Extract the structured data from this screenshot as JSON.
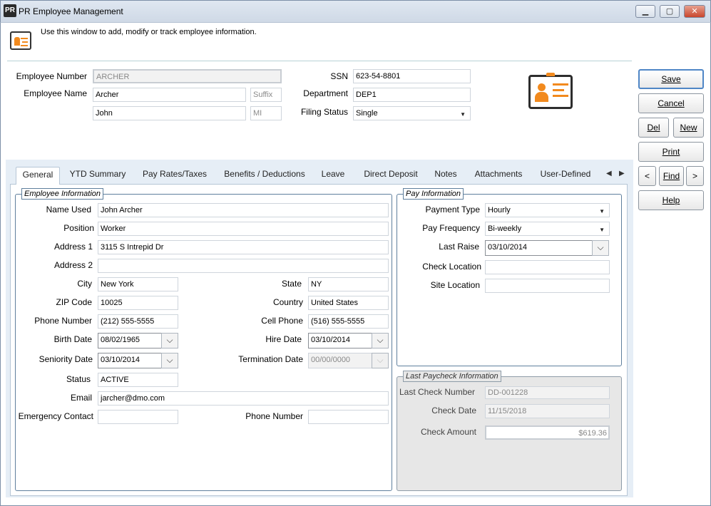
{
  "window": {
    "app_icon_text": "PR",
    "title": "PR Employee Management",
    "minimize_glyph": "▁",
    "maximize_glyph": "▢",
    "close_glyph": "✕"
  },
  "header": {
    "description": "Use this window to add, modify or track employee information.",
    "icon": "employee-card-icon"
  },
  "top_form": {
    "employee_number_label": "Employee Number",
    "employee_number_value": "ARCHER",
    "employee_name_label": "Employee Name",
    "last_name_value": "Archer",
    "suffix_placeholder": "Suffix",
    "first_name_value": "John",
    "mi_placeholder": "MI",
    "ssn_label": "SSN",
    "ssn_value": "623-54-8801",
    "department_label": "Department",
    "department_value": "DEP1",
    "filing_status_label": "Filing Status",
    "filing_status_value": "Single"
  },
  "side_buttons": {
    "save": "Save",
    "cancel": "Cancel",
    "del": "Del",
    "new": "New",
    "print": "Print",
    "prev": "<",
    "find": "Find",
    "next": ">",
    "help": "Help"
  },
  "tabs": [
    {
      "label": "General",
      "active": true
    },
    {
      "label": "YTD Summary"
    },
    {
      "label": "Pay Rates/Taxes"
    },
    {
      "label": "Benefits / Deductions"
    },
    {
      "label": "Leave"
    },
    {
      "label": "Direct Deposit"
    },
    {
      "label": "Notes"
    },
    {
      "label": "Attachments"
    },
    {
      "label": "User-Defined"
    }
  ],
  "tab_scroll": {
    "left": "◀",
    "right": "▶"
  },
  "employee_info": {
    "legend": "Employee Information",
    "name_used_label": "Name Used",
    "name_used_value": "John Archer",
    "position_label": "Position",
    "position_value": "Worker",
    "address1_label": "Address 1",
    "address1_value": "3115 S Intrepid Dr",
    "address2_label": "Address 2",
    "address2_value": "",
    "city_label": "City",
    "city_value": "New York",
    "state_label": "State",
    "state_value": "NY",
    "zip_label": "ZIP Code",
    "zip_value": "10025",
    "country_label": "Country",
    "country_value": "United States",
    "phone_label": "Phone Number",
    "phone_value": "(212) 555-5555",
    "cell_label": "Cell Phone",
    "cell_value": "(516) 555-5555",
    "birth_label": "Birth Date",
    "birth_value": "08/02/1965",
    "hire_label": "Hire Date",
    "hire_value": "03/10/2014",
    "seniority_label": "Seniority Date",
    "seniority_value": "03/10/2014",
    "termination_label": "Termination Date",
    "termination_value": "00/00/0000",
    "status_label": "Status",
    "status_value": "ACTIVE",
    "email_label": "Email",
    "email_value": "jarcher@dmo.com",
    "emergency_label": "Emergency Contact",
    "emergency_value": "",
    "emergency_phone_label": "Phone Number",
    "emergency_phone_value": ""
  },
  "pay_info": {
    "legend": "Pay Information",
    "payment_type_label": "Payment Type",
    "payment_type_value": "Hourly",
    "pay_frequency_label": "Pay Frequency",
    "pay_frequency_value": "Bi-weekly",
    "last_raise_label": "Last Raise",
    "last_raise_value": "03/10/2014",
    "check_location_label": "Check Location",
    "check_location_value": "",
    "site_location_label": "Site Location",
    "site_location_value": ""
  },
  "last_paycheck": {
    "legend": "Last Paycheck Information",
    "last_check_label": "Last Check Number",
    "last_check_value": "DD-001228",
    "check_date_label": "Check Date",
    "check_date_value": "11/15/2018",
    "check_amount_label": "Check Amount",
    "check_amount_value": "$619.36"
  },
  "glyphs": {
    "chevron": "⌵"
  }
}
